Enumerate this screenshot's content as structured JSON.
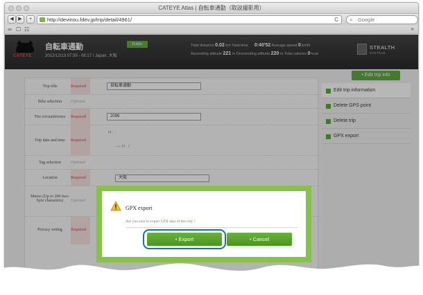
{
  "window": {
    "title": "CATEYE Atlas | 自転車通勤（取説撮影用）"
  },
  "toolbar": {
    "back_label": "◀",
    "forward_label": "▶",
    "add_label": "+",
    "url": "http://devinou.fdev.jp/trip/detail/4961/",
    "reload_glyph": "C",
    "search_placeholder": "Google"
  },
  "bookmarks": {
    "reader_icon": "∞",
    "book_icon": "☐",
    "grid_icon": "☷",
    "more_label": "»"
  },
  "header": {
    "trip_name": "自転車通勤",
    "date_line": "2012/12/13 07:59 - 08:17 / Japan, 大阪",
    "public_badge": "Public",
    "stats_row1_label1": "Total distance",
    "stats_row1_val1": "0.02",
    "stats_row1_unit1": "km",
    "stats_row1_label2": "Total time",
    "stats_row1_val2": "0:40'52",
    "stats_row1_label3": "Average speed",
    "stats_row1_val3": "0",
    "stats_row1_unit3": "km/h",
    "stats_row2_label1": "Ascending altitude",
    "stats_row2_val1": "221",
    "stats_row2_unit1": "m",
    "stats_row2_label2": "Descending altitude",
    "stats_row2_val2": "220",
    "stats_row2_unit2": "m",
    "stats_row2_label3": "Total calories",
    "stats_row2_val3": "0",
    "stats_row2_unit3": "kcal",
    "device_name": "STEALTH",
    "device_sub": "EVO PLUS",
    "logo_text": "CATEYE"
  },
  "edit_tab_label": "• Edit trip info",
  "form": {
    "rows": [
      {
        "label": "Trip title",
        "req": "Required",
        "value": "自転車通勤"
      },
      {
        "label": "Bike selection",
        "req": "Optional",
        "value": ""
      },
      {
        "label": "Tire circumference",
        "req": "Required",
        "value": "2096"
      },
      {
        "label": "Trip date and time",
        "req": "Required",
        "value": "H   :   :"
      },
      {
        "label": "Tag selection",
        "req": "Optional",
        "value": ""
      },
      {
        "label": "Location",
        "req": "Required",
        "value": "大阪"
      },
      {
        "label": "Memo (Up to 200 two-byte characters)",
        "req": "Optional",
        "value": ""
      },
      {
        "label": "Privacy setting",
        "req": "Required",
        "value": ""
      }
    ],
    "date_sub": "— H   :   /"
  },
  "sidemenu": [
    {
      "label": "Edit trip information"
    },
    {
      "label": "Delete GPS point"
    },
    {
      "label": "Delete trip"
    },
    {
      "label": "GPX export"
    }
  ],
  "dialog": {
    "title": "GPX export",
    "message": "Are you sure to export GPX data of this trip ?",
    "export_label": "• Export",
    "cancel_label": "• Cancel"
  },
  "colors": {
    "accent_green": "#58a635",
    "dialog_frame": "#86c24a",
    "highlight_ring": "#1c6fa3",
    "required_red": "#d23b2e"
  }
}
